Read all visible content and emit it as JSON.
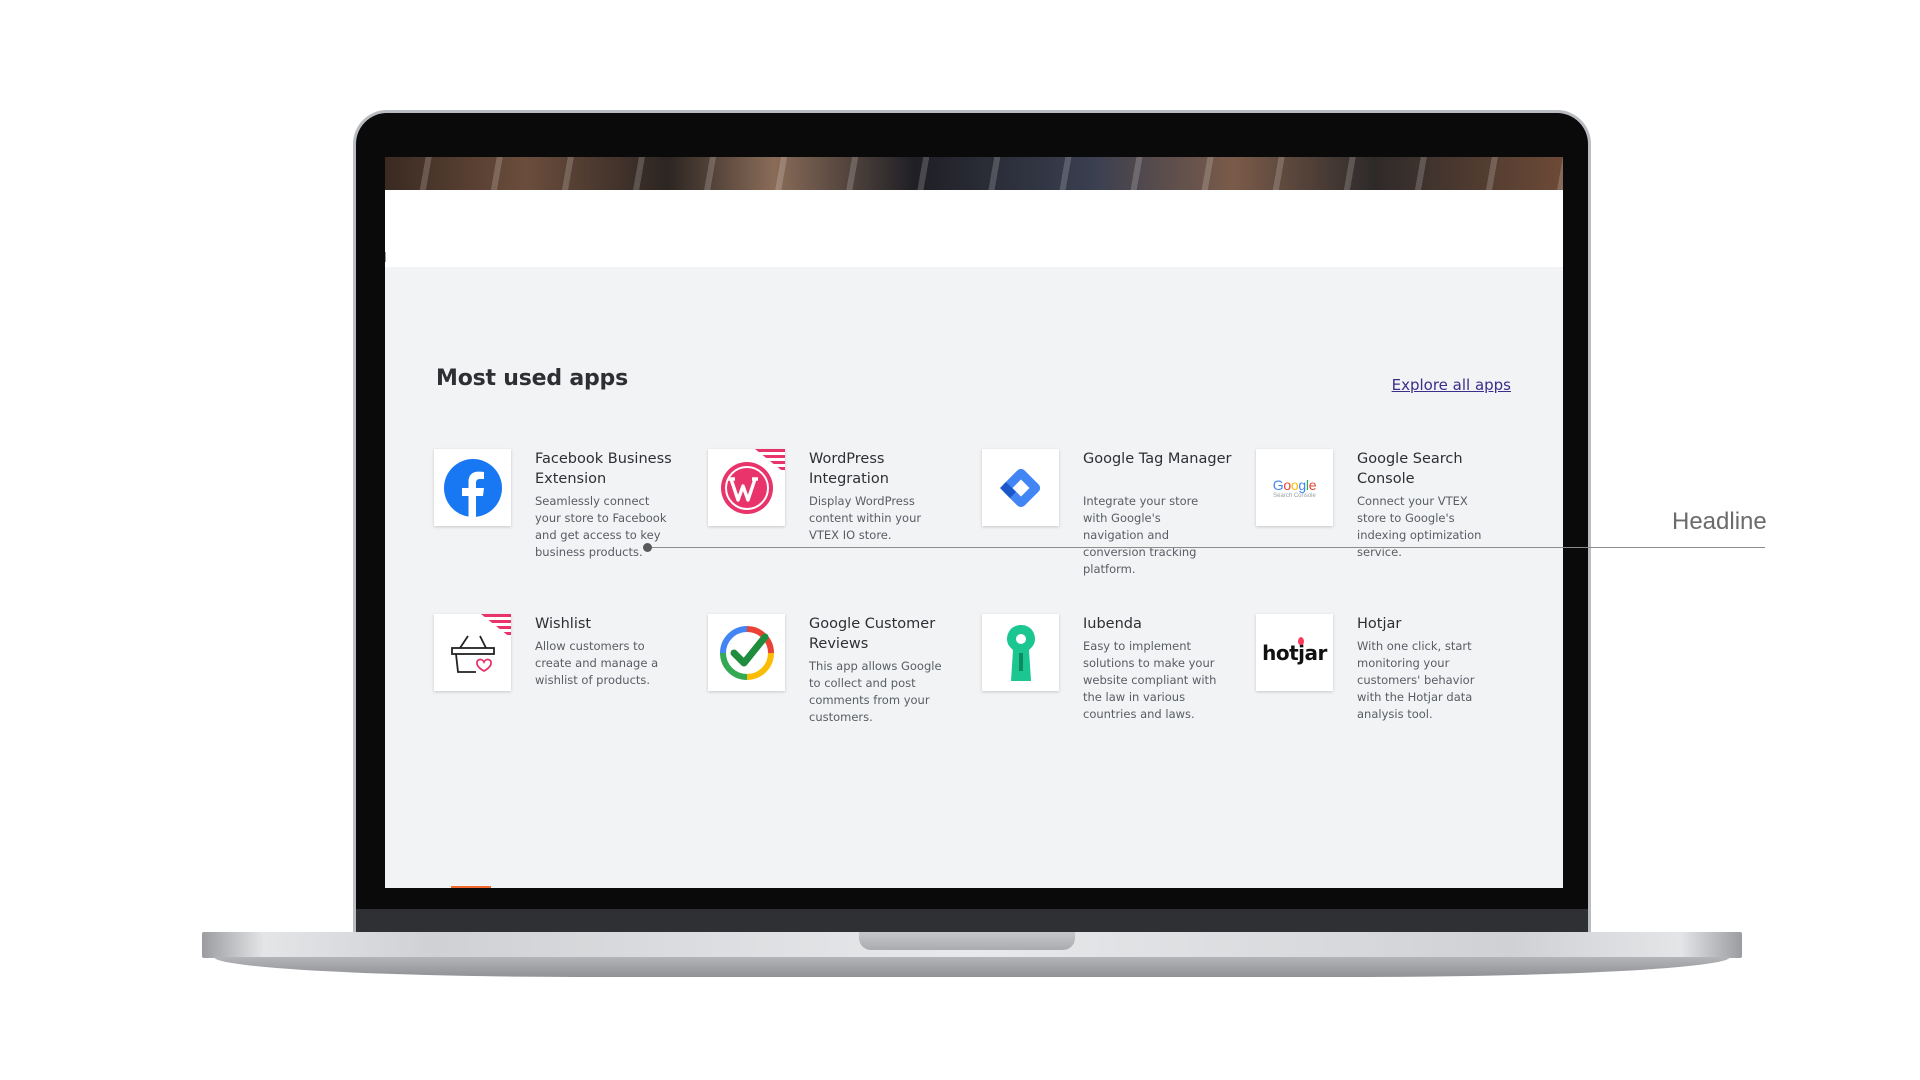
{
  "section": {
    "title": "Most used apps",
    "explore_link": "Explore all apps"
  },
  "apps": [
    {
      "name": "Facebook Business Extension",
      "description": "Seamlessly connect your store to Facebook and get access to key business products.",
      "icon": "facebook-icon",
      "badge": false
    },
    {
      "name": "WordPress Integration",
      "description": "Display WordPress content within your VTEX IO store.",
      "icon": "wordpress-icon",
      "badge": true
    },
    {
      "name": "Google Tag Manager",
      "description": "Integrate your store with Google's navigation and conversion tracking platform.",
      "icon": "google-tag-manager-icon",
      "badge": false
    },
    {
      "name": "Google Search Console",
      "description": "Connect your VTEX store to Google's indexing optimization service.",
      "icon": "google-search-console-icon",
      "icon_text": "Google",
      "icon_subtext": "Search Console",
      "badge": false
    },
    {
      "name": "Wishlist",
      "description": "Allow customers to create and manage a wishlist of products.",
      "icon": "wishlist-basket-icon",
      "badge": true
    },
    {
      "name": "Google Customer Reviews",
      "description": "This app allows Google to collect and post comments from your customers.",
      "icon": "google-customer-reviews-icon",
      "badge": false
    },
    {
      "name": "Iubenda",
      "description": "Easy to implement solutions to make your website compliant with the law in various countries and laws.",
      "icon": "iubenda-keyhole-icon",
      "badge": false
    },
    {
      "name": "Hotjar",
      "description": "With one click, start monitoring your customers' behavior with the Hotjar data analysis tool.",
      "icon": "hotjar-icon",
      "icon_text": "hotjar",
      "badge": false
    }
  ],
  "annotation": {
    "label": "Headline"
  },
  "colors": {
    "screen_background": "#f2f3f5",
    "link": "#3b2d8a",
    "badge": "#e8336b",
    "facebook": "#1877f2",
    "wordpress": "#e8336b",
    "iubenda": "#1cc691"
  }
}
